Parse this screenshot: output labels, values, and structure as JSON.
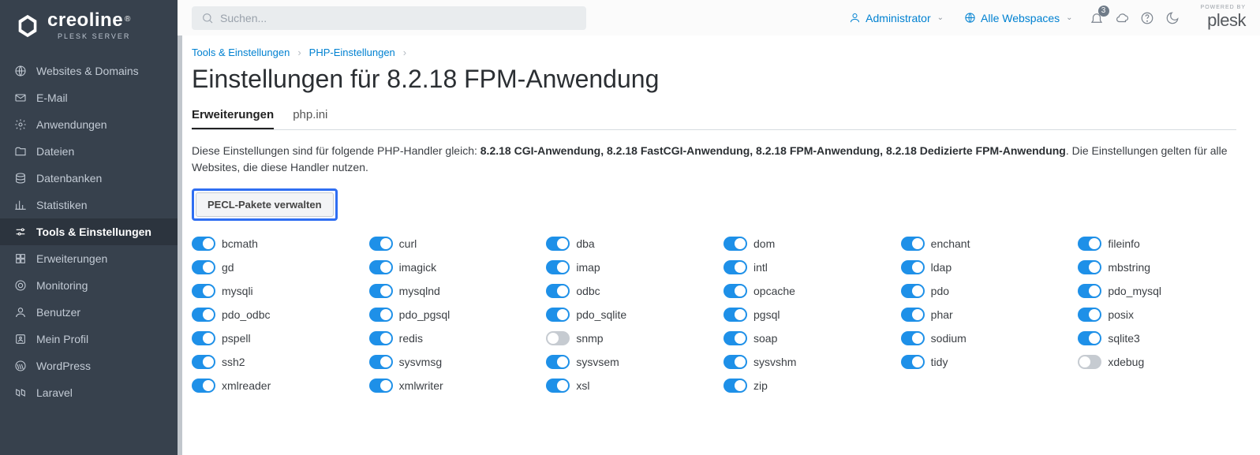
{
  "brand": {
    "name": "creoline",
    "sub": "PLESK SERVER",
    "reg": "®"
  },
  "sidebar": {
    "items": [
      {
        "label": "Websites & Domains",
        "icon": "globe"
      },
      {
        "label": "E-Mail",
        "icon": "mail"
      },
      {
        "label": "Anwendungen",
        "icon": "gear"
      },
      {
        "label": "Dateien",
        "icon": "folder"
      },
      {
        "label": "Datenbanken",
        "icon": "database"
      },
      {
        "label": "Statistiken",
        "icon": "stats"
      },
      {
        "label": "Tools & Einstellungen",
        "icon": "sliders",
        "active": true
      },
      {
        "label": "Erweiterungen",
        "icon": "puzzle"
      },
      {
        "label": "Monitoring",
        "icon": "monitor"
      },
      {
        "label": "Benutzer",
        "icon": "user"
      },
      {
        "label": "Mein Profil",
        "icon": "profile"
      },
      {
        "label": "WordPress",
        "icon": "wordpress"
      },
      {
        "label": "Laravel",
        "icon": "laravel"
      }
    ]
  },
  "topbar": {
    "search_placeholder": "Suchen...",
    "user": "Administrator",
    "webspaces": "Alle Webspaces",
    "notification_count": "3",
    "powered": "POWERED BY",
    "plesk": "plesk"
  },
  "breadcrumbs": [
    {
      "label": "Tools & Einstellungen"
    },
    {
      "label": "PHP-Einstellungen"
    }
  ],
  "page_title": "Einstellungen für 8.2.18 FPM-Anwendung",
  "tabs": [
    {
      "label": "Erweiterungen",
      "active": true
    },
    {
      "label": "php.ini",
      "active": false
    }
  ],
  "desc": {
    "prefix": "Diese Einstellungen sind für folgende PHP-Handler gleich: ",
    "handlers": "8.2.18 CGI-Anwendung, 8.2.18 FastCGI-Anwendung, 8.2.18 FPM-Anwendung, 8.2.18 Dedizierte FPM-Anwendung",
    "suffix": ". Die Einstellungen gelten für alle Websites, die diese Handler nutzen."
  },
  "pecl_button": "PECL-Pakete verwalten",
  "extensions": [
    {
      "name": "bcmath",
      "on": true
    },
    {
      "name": "curl",
      "on": true
    },
    {
      "name": "dba",
      "on": true
    },
    {
      "name": "dom",
      "on": true
    },
    {
      "name": "enchant",
      "on": true
    },
    {
      "name": "fileinfo",
      "on": true
    },
    {
      "name": "gd",
      "on": true
    },
    {
      "name": "imagick",
      "on": true
    },
    {
      "name": "imap",
      "on": true
    },
    {
      "name": "intl",
      "on": true
    },
    {
      "name": "ldap",
      "on": true
    },
    {
      "name": "mbstring",
      "on": true
    },
    {
      "name": "mysqli",
      "on": true
    },
    {
      "name": "mysqlnd",
      "on": true
    },
    {
      "name": "odbc",
      "on": true
    },
    {
      "name": "opcache",
      "on": true
    },
    {
      "name": "pdo",
      "on": true
    },
    {
      "name": "pdo_mysql",
      "on": true
    },
    {
      "name": "pdo_odbc",
      "on": true
    },
    {
      "name": "pdo_pgsql",
      "on": true
    },
    {
      "name": "pdo_sqlite",
      "on": true
    },
    {
      "name": "pgsql",
      "on": true
    },
    {
      "name": "phar",
      "on": true
    },
    {
      "name": "posix",
      "on": true
    },
    {
      "name": "pspell",
      "on": true
    },
    {
      "name": "redis",
      "on": true
    },
    {
      "name": "snmp",
      "on": false
    },
    {
      "name": "soap",
      "on": true
    },
    {
      "name": "sodium",
      "on": true
    },
    {
      "name": "sqlite3",
      "on": true
    },
    {
      "name": "ssh2",
      "on": true
    },
    {
      "name": "sysvmsg",
      "on": true
    },
    {
      "name": "sysvsem",
      "on": true
    },
    {
      "name": "sysvshm",
      "on": true
    },
    {
      "name": "tidy",
      "on": true
    },
    {
      "name": "xdebug",
      "on": false
    },
    {
      "name": "xmlreader",
      "on": true
    },
    {
      "name": "xmlwriter",
      "on": true
    },
    {
      "name": "xsl",
      "on": true
    },
    {
      "name": "zip",
      "on": true
    }
  ]
}
